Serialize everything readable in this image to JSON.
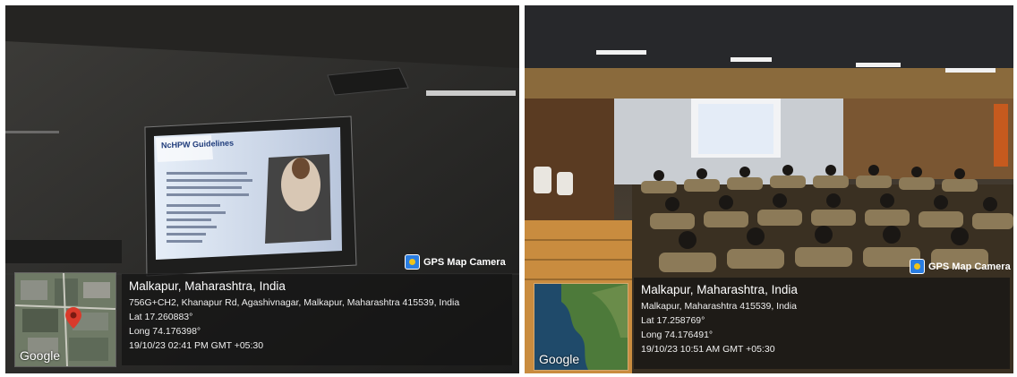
{
  "left_photo": {
    "stamp_label": "GPS Map Camera",
    "map_logo": "Google",
    "slide_title": "NcHPW Guidelines",
    "place": "Malkapur, Maharashtra, India",
    "address": "756G+CH2, Khanapur Rd, Agashivnagar, Malkapur, Maharashtra 415539, India",
    "lat": "Lat 17.260883°",
    "long": "Long 74.176398°",
    "datetime": "19/10/23 02:41 PM GMT +05:30",
    "pin_color": "#d93a2b"
  },
  "right_photo": {
    "stamp_label": "GPS Map Camera",
    "map_logo": "Google",
    "place": "Malkapur, Maharashtra, India",
    "address": "Malkapur, Maharashtra 415539, India",
    "lat": "Lat 17.258769°",
    "long": "Long 74.176491°",
    "datetime": "19/10/23 10:51 AM GMT +05:30"
  },
  "icons": [
    "gps-map-camera-icon",
    "location-pin-icon"
  ]
}
